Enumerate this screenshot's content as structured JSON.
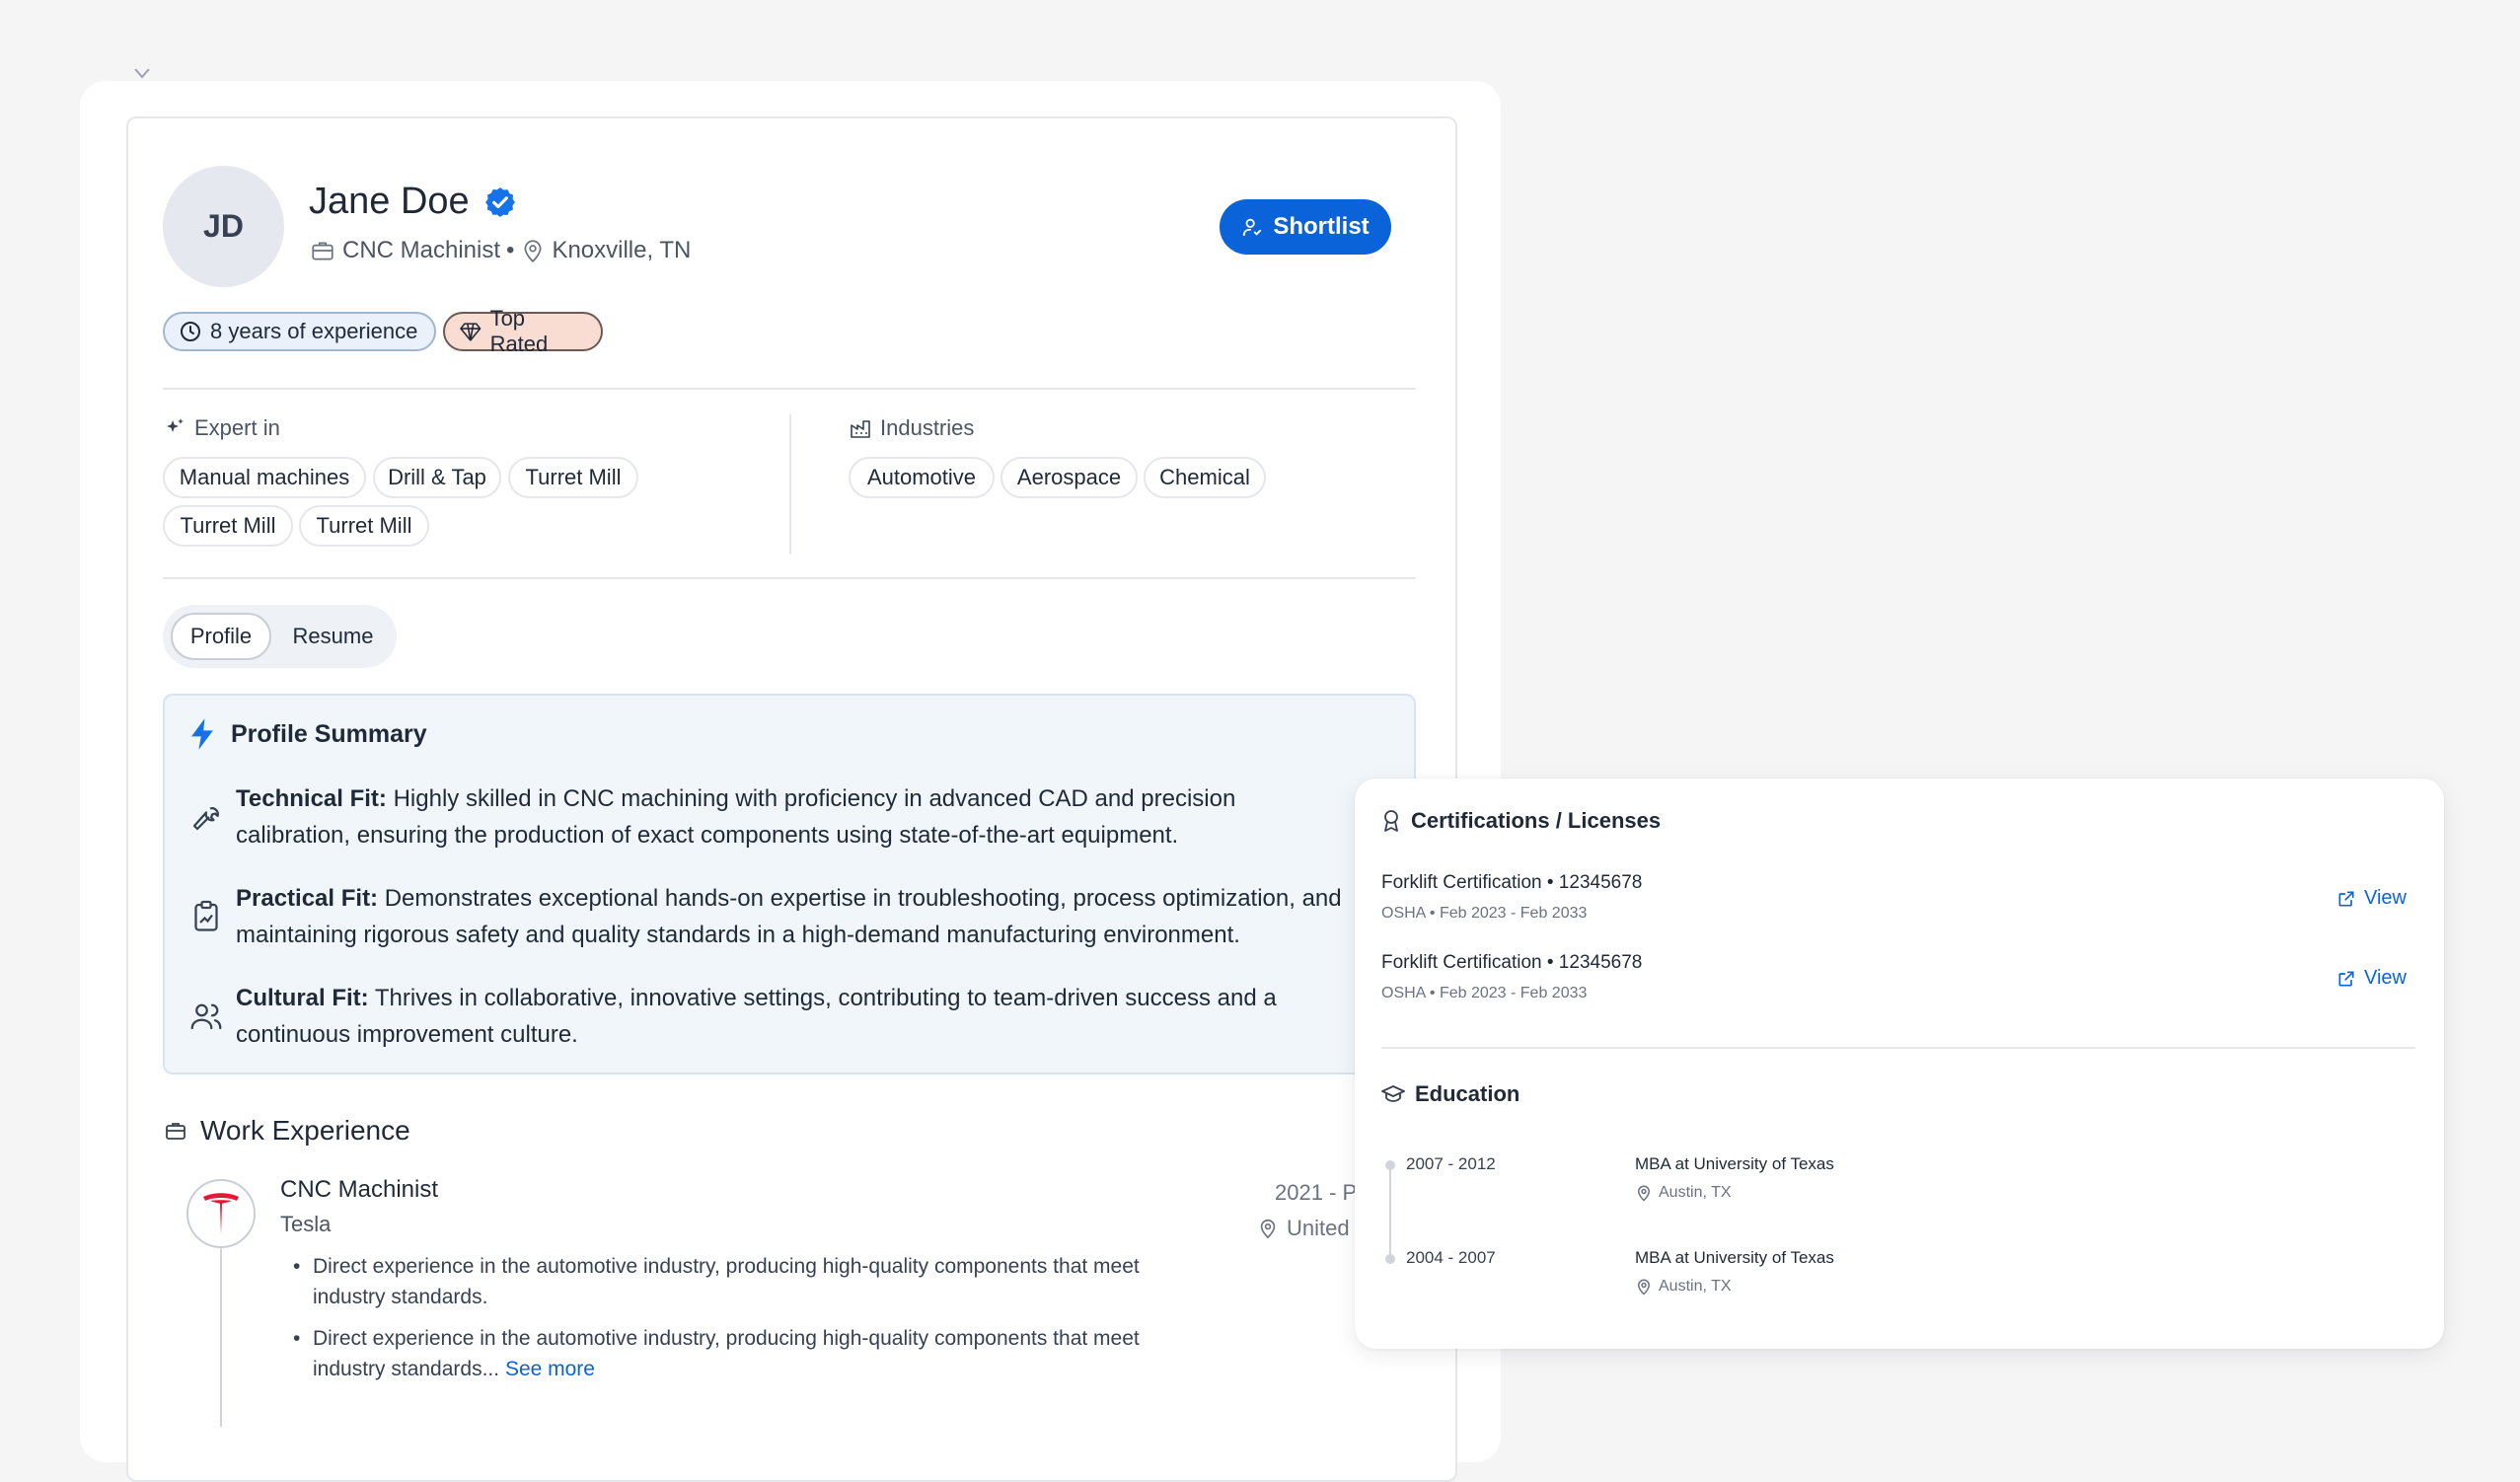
{
  "profile": {
    "initials": "JD",
    "name": "Jane Doe",
    "title": "CNC Machinist",
    "separator": "•",
    "location": "Knoxville, TN",
    "shortlist_label": "Shortlist",
    "badges": {
      "experience": "8 years of experience",
      "rating": "Top Rated"
    }
  },
  "expertise": {
    "label": "Expert in",
    "items": [
      "Manual machines",
      "Drill & Tap",
      "Turret Mill",
      "Turret Mill",
      "Turret Mill"
    ]
  },
  "industries": {
    "label": "Industries",
    "items": [
      "Automotive",
      "Aerospace",
      "Chemical"
    ]
  },
  "tabs": [
    {
      "label": "Profile",
      "active": true
    },
    {
      "label": "Resume",
      "active": false
    }
  ],
  "summary": {
    "title": "Profile Summary",
    "fits": [
      {
        "label": "Technical Fit:",
        "text": "Highly skilled in CNC machining with proficiency in advanced CAD and precision calibration, ensuring the production of exact components using state-of-the-art equipment."
      },
      {
        "label": "Practical Fit:",
        "text": "Demonstrates exceptional hands-on expertise in troubleshooting, process optimization, and maintaining rigorous safety and quality standards in a high-demand manufacturing environment."
      },
      {
        "label": "Cultural Fit:",
        "text": "Thrives in collaborative, innovative settings, contributing to team-driven success and a continuous improvement culture."
      }
    ]
  },
  "work": {
    "title": "Work Experience",
    "jobs": [
      {
        "title": "CNC Machinist",
        "company": "Tesla",
        "date": "2021 - P",
        "location": "United",
        "bullets": [
          "Direct experience in the automotive industry, producing high-quality components that meet industry standards.",
          "Direct experience in the automotive industry, producing high-quality components that meet industry standards..."
        ],
        "see_more": "See more"
      }
    ]
  },
  "certifications": {
    "title": "Certifications / Licenses",
    "view_label": "View",
    "items": [
      {
        "name": "Forklift Certification • 12345678",
        "meta": "OSHA • Feb 2023 - Feb 2033"
      },
      {
        "name": "Forklift Certification • 12345678",
        "meta": "OSHA • Feb 2023 - Feb 2033"
      }
    ]
  },
  "education": {
    "title": "Education",
    "items": [
      {
        "years": "2007 - 2012",
        "degree": "MBA at University of Texas",
        "location": "Austin, TX"
      },
      {
        "years": "2004 - 2007",
        "degree": "MBA at University of Texas",
        "location": "Austin, TX"
      }
    ]
  },
  "colors": {
    "accent": "#0b63d9",
    "verified": "#1572e8",
    "tesla_red": "#e31937",
    "summary_bg": "#f1f6fb"
  }
}
